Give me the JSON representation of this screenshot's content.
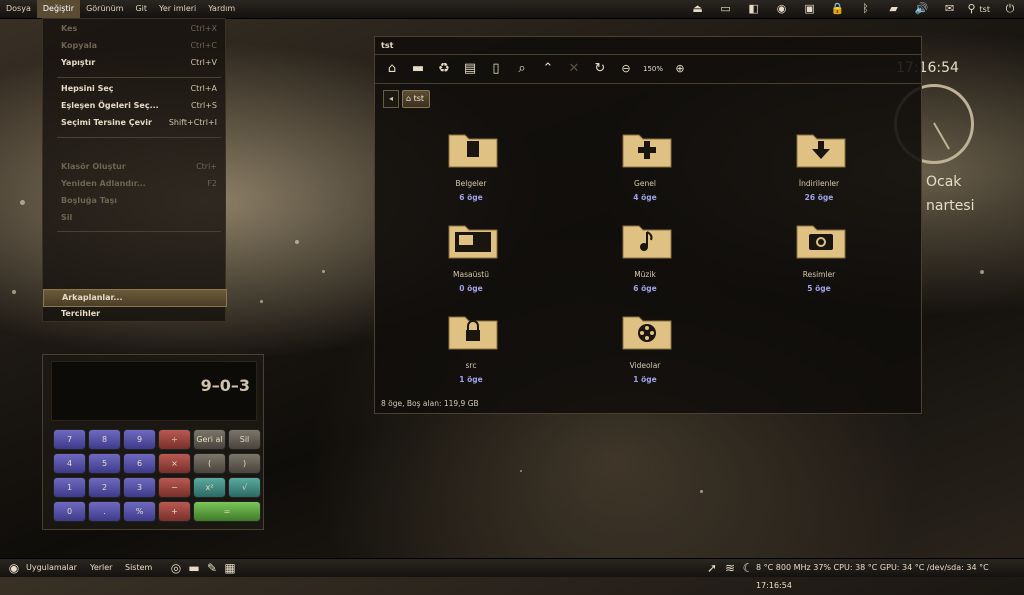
{
  "top_panel": {
    "menus": [
      "Dosya",
      "Değiştir",
      "Görünüm",
      "Git",
      "Yer imleri",
      "Yardım"
    ],
    "active_menu_index": 1,
    "tray_icons": [
      "eject-icon",
      "drive-icon",
      "removable-media-icon",
      "nvidia-icon",
      "display-icon",
      "lock-icon",
      "bluetooth-icon",
      "battery-icon",
      "volume-icon",
      "mail-icon",
      "search-icon",
      "power-icon"
    ],
    "search_label": "tst"
  },
  "edit_menu": {
    "items": [
      {
        "label": "Kes",
        "accel": "Ctrl+X",
        "dim": true
      },
      {
        "label": "Kopyala",
        "accel": "Ctrl+C",
        "dim": true
      },
      {
        "label": "Yapıştır",
        "accel": "Ctrl+V",
        "dim": false
      },
      {
        "label": "Hepsini Seç",
        "accel": "Ctrl+A",
        "dim": false
      },
      {
        "label": "Eşleşen Ögeleri Seç...",
        "accel": "Ctrl+S",
        "dim": false
      },
      {
        "label": "Seçimi Tersine Çevir",
        "accel": "Shift+Ctrl+I",
        "dim": false
      },
      {
        "label": "Klasör Oluştur",
        "accel": "Ctrl+",
        "dim": true
      },
      {
        "label": "Yeniden Adlandır...",
        "accel": "F2",
        "dim": true
      },
      {
        "label": "Boşluğa Taşı",
        "accel": "",
        "dim": true
      },
      {
        "label": "Sil",
        "accel": "",
        "dim": true
      },
      {
        "label": "Arkaplanlar...",
        "accel": "",
        "dim": false
      },
      {
        "label": "Tercihler",
        "accel": "",
        "dim": false
      }
    ],
    "highlighted_index": 10
  },
  "calculator": {
    "display": "9–0–3",
    "keys": [
      [
        "7",
        "8",
        "9",
        "÷",
        "Geri al",
        "Sil"
      ],
      [
        "4",
        "5",
        "6",
        "×",
        "(",
        ")"
      ],
      [
        "1",
        "2",
        "3",
        "−",
        "x²",
        "√"
      ],
      [
        "0",
        ".",
        "%",
        "+",
        "="
      ]
    ]
  },
  "file_manager": {
    "title": "tst",
    "zoom": "150%",
    "toolbar_icons": [
      "home-icon",
      "computer-icon",
      "trash-icon",
      "new-folder-icon",
      "file-icon",
      "find-icon",
      "up-icon",
      "stop-icon",
      "reload-icon",
      "zoom-out-icon",
      "zoom-in-icon"
    ],
    "breadcrumb": {
      "back": "◂",
      "current": "tst"
    },
    "folders": [
      {
        "name": "Belgeler",
        "count": "6 öge",
        "glyph": "■"
      },
      {
        "name": "Genel",
        "count": "4 öge",
        "glyph": "✚"
      },
      {
        "name": "İndirilenler",
        "count": "26 öge",
        "glyph": "▼"
      },
      {
        "name": "Masaüstü",
        "count": "0 öge",
        "glyph": "▭"
      },
      {
        "name": "Müzik",
        "count": "6 öge",
        "glyph": "♪"
      },
      {
        "name": "Resimler",
        "count": "5 öge",
        "glyph": "◉"
      },
      {
        "name": "src",
        "count": "1 öge",
        "glyph": "🔒"
      },
      {
        "name": "Videolar",
        "count": "1 öge",
        "glyph": "✇"
      }
    ],
    "status": "8 öge, Boş alan: 119,9 GB"
  },
  "desktop_clock": {
    "time": "17:16:54",
    "date": "Ocak",
    "day": "nartesi"
  },
  "bottom_panel": {
    "menus": [
      "Uygulamalar",
      "Yerler",
      "Sistem"
    ],
    "status_line": "8 °C 800 MHz 37%  CPU: 38 °C   GPU: 34 °C   /dev/sda: 34 °C  17:16:54"
  },
  "colors": {
    "accent": "#e8c98a",
    "folder": "#e0c184",
    "count_text": "#9fa2e8"
  }
}
